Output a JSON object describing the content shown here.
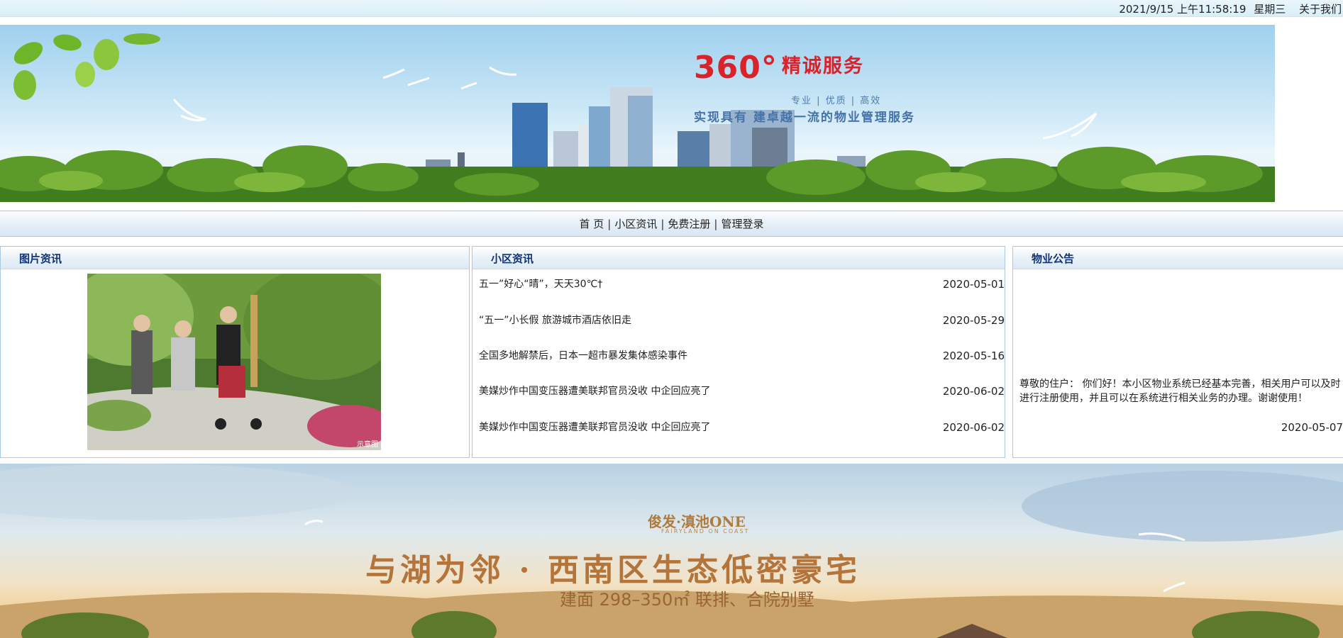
{
  "topbar": {
    "datetime": "2021/9/15 上午11:58:19",
    "weekday": "星期三",
    "about": "关于我们"
  },
  "banner": {
    "slogan": "360°",
    "slogan_sub": "精诚服务",
    "tags": "专业 | 优质 | 高效",
    "line": "实现具有  建卓越一流的物业管理服务"
  },
  "nav": {
    "items": [
      "首 页",
      "小区资讯",
      "免费注册",
      "管理登录"
    ],
    "separator": "|"
  },
  "panels": {
    "photo": {
      "title": "图片资讯",
      "tag": "示意图"
    },
    "news": {
      "title": "小区资讯",
      "items": [
        {
          "title": "五一”好心“晴”，天天30℃†",
          "date": "2020-05-01"
        },
        {
          "title": "“五一”小长假 旅游城市酒店依旧走",
          "date": "2020-05-29"
        },
        {
          "title": "全国多地解禁后，日本一超市暴发集体感染事件",
          "date": "2020-05-16"
        },
        {
          "title": "美媒炒作中国变压器遭美联邦官员没收 中企回应亮了",
          "date": "2020-06-02"
        },
        {
          "title": "美媒炒作中国变压器遭美联邦官员没收 中企回应亮了",
          "date": "2020-06-02"
        }
      ]
    },
    "notice": {
      "title": "物业公告",
      "text": "尊敬的住户： 你们好！本小区物业系统已经基本完善，相关用户可以及时进行注册使用，并且可以在系统进行相关业务的办理。谢谢使用！",
      "date": "2020-05-07"
    }
  },
  "bottom_banner": {
    "brand": "俊发·滇池ONE",
    "brand_sub": "FAIRYLAND ON COAST",
    "title": "与湖为邻 · 西南区生态低密豪宅",
    "subtitle": "建面 298–350㎡ 联排、合院别墅"
  }
}
